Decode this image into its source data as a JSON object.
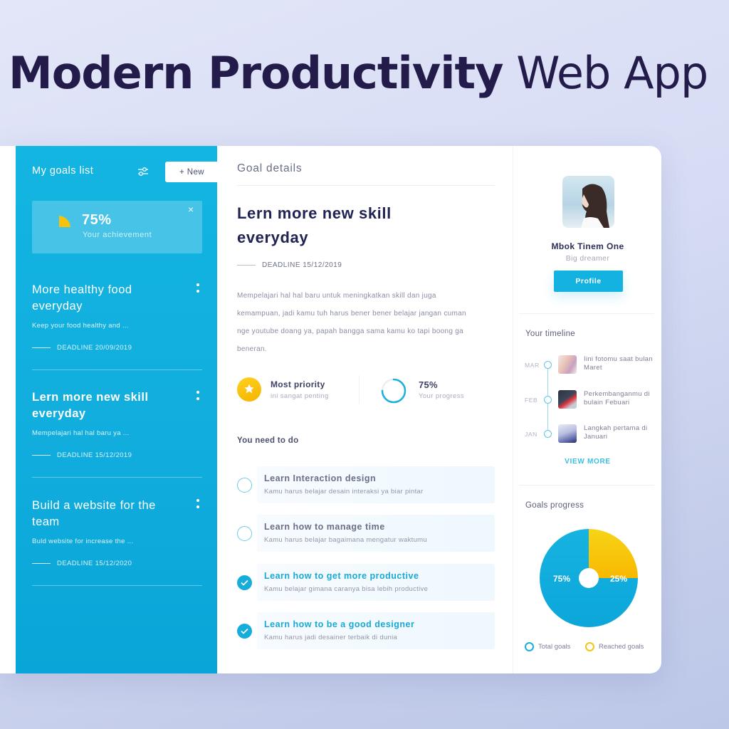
{
  "hero": {
    "title_bold": "Modern Productivity",
    "title_light": "Web App"
  },
  "colors": {
    "accent": "#14b2e0",
    "yellow": "#f7c20c",
    "heading": "#231c4a"
  },
  "sidebar": {
    "title": "My goals list",
    "new_button": "+ New",
    "achievement": {
      "percent": "75%",
      "label": "Your achievement",
      "close": "×"
    },
    "goals": [
      {
        "title": "More healthy food everyday",
        "desc": "Keep your food healthy and ...",
        "deadline": "DEADLINE 20/09/2019",
        "active": false
      },
      {
        "title": "Lern more new skill everyday",
        "desc": "Mempelajari hal hal baru ya ...",
        "deadline": "DEADLINE 15/12/2019",
        "active": true
      },
      {
        "title": "Build a website for the team",
        "desc": "Buld website for increase the ...",
        "deadline": "DEADLINE 15/12/2020",
        "active": false
      }
    ]
  },
  "main": {
    "header": "Goal details",
    "title": "Lern more new skill everyday",
    "deadline": "DEADLINE 15/12/2019",
    "description": "Mempelajari hal hal baru untuk meningkatkan skill dan juga kemampuan, jadi kamu tuh harus bener bener belajar jangan cuman nge youtube doang ya, papah bangga sama kamu ko tapi boong ga beneran.",
    "priority": {
      "title": "Most priority",
      "sub": "ini sangat penting"
    },
    "progress": {
      "value": 0.75,
      "label": "75%",
      "sub": "Your progress"
    },
    "todo_header": "You need to do",
    "todos": [
      {
        "title": "Learn Interaction design",
        "sub": "Kamu harus belajar desain interaksi ya biar pintar",
        "done": false
      },
      {
        "title": "Learn how to manage time",
        "sub": "Kamu harus belajar bagaimana mengatur waktumu",
        "done": false
      },
      {
        "title": "Learn how to get more productive",
        "sub": "Kamu belajar gimana caranya bisa lebih productive",
        "done": true
      },
      {
        "title": "Learn how to be a good designer",
        "sub": "Kamu harus jadi desainer terbaik di dunia",
        "done": true
      }
    ]
  },
  "profile": {
    "name": "Mbok Tinem One",
    "role": "Big dreamer",
    "button": "Profile"
  },
  "timeline": {
    "header": "Your timeline",
    "items": [
      {
        "month": "MAR",
        "text": "Iini fotomu saat bulan Maret"
      },
      {
        "month": "FEB",
        "text": "Perkembanganmu di bulain Febuari"
      },
      {
        "month": "JAN",
        "text": "Langkah pertama di Januari"
      }
    ],
    "view_more": "VIEW MORE"
  },
  "goals_progress": {
    "header": "Goals progress",
    "legend": [
      "Total goals",
      "Reached goals"
    ]
  },
  "chart_data": {
    "type": "pie",
    "title": "Goals progress",
    "categories": [
      "Total goals",
      "Reached goals"
    ],
    "values": [
      75,
      25
    ],
    "labels": [
      "75%",
      "25%"
    ],
    "colors": [
      "#14aedd",
      "#f7c20c"
    ],
    "legend": "bottom"
  }
}
